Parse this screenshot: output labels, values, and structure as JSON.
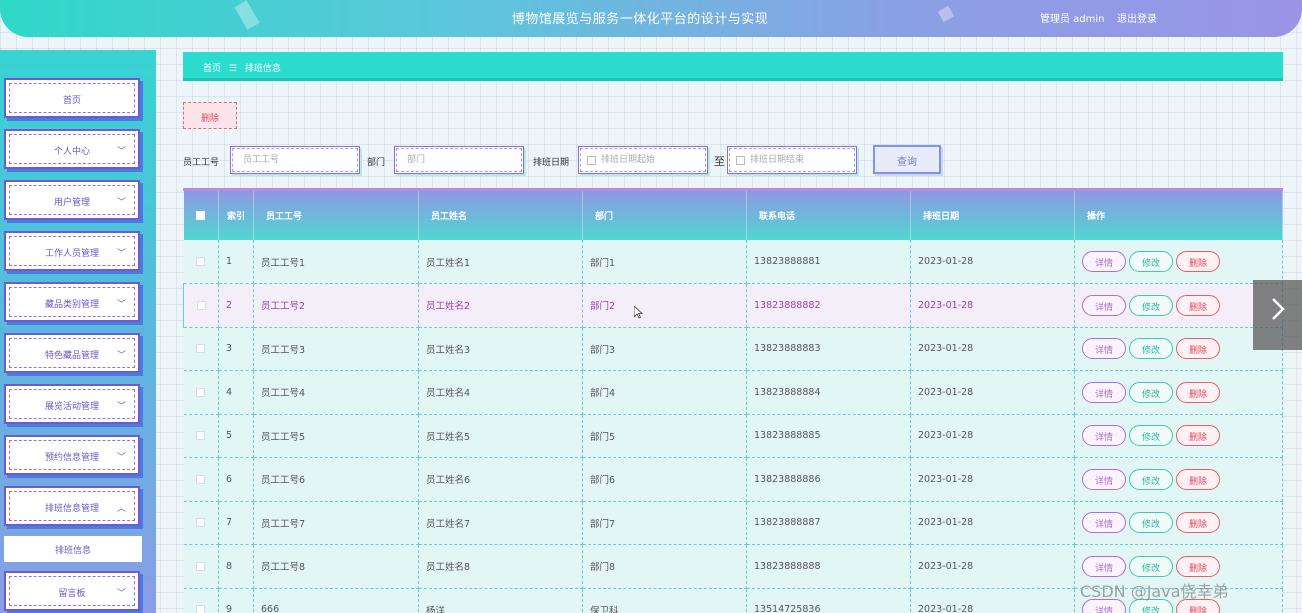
{
  "header": {
    "title": "博物馆展览与服务一体化平台的设计与实现",
    "user": "管理员 admin",
    "logout": "退出登录"
  },
  "sidebar": {
    "items": [
      {
        "label": "首页",
        "chevron": ""
      },
      {
        "label": "个人中心",
        "chevron": "﹀"
      },
      {
        "label": "用户管理",
        "chevron": "﹀"
      },
      {
        "label": "工作人员管理",
        "chevron": "﹀"
      },
      {
        "label": "藏品类别管理",
        "chevron": "﹀"
      },
      {
        "label": "特色藏品管理",
        "chevron": "﹀"
      },
      {
        "label": "展览活动管理",
        "chevron": "﹀"
      },
      {
        "label": "预约信息管理",
        "chevron": "﹀"
      },
      {
        "label": "排班信息管理",
        "chevron": "︿"
      },
      {
        "label": "留言板",
        "chevron": "﹀"
      }
    ],
    "sub_item": "排班信息"
  },
  "breadcrumb": {
    "home": "首页",
    "separator": "☰",
    "current": "排班信息"
  },
  "actions": {
    "delete": "删除",
    "query": "查询",
    "to": "至"
  },
  "search": {
    "emp_no_label": "员工工号",
    "emp_no_placeholder": "员工工号",
    "dept_label": "部门",
    "dept_placeholder": "部门",
    "date_label": "排班日期",
    "date_start_placeholder": "排班日期起始",
    "date_end_placeholder": "排班日期结束"
  },
  "table": {
    "columns": [
      "索引",
      "员工工号",
      "员工姓名",
      "部门",
      "联系电话",
      "排班日期",
      "操作"
    ],
    "ops": {
      "detail": "详情",
      "edit": "修改",
      "delete": "删除"
    },
    "rows": [
      {
        "idx": "1",
        "emp_no": "员工工号1",
        "name": "员工姓名1",
        "dept": "部门1",
        "phone": "13823888881",
        "date": "2023-01-28"
      },
      {
        "idx": "2",
        "emp_no": "员工工号2",
        "name": "员工姓名2",
        "dept": "部门2",
        "phone": "13823888882",
        "date": "2023-01-28"
      },
      {
        "idx": "3",
        "emp_no": "员工工号3",
        "name": "员工姓名3",
        "dept": "部门3",
        "phone": "13823888883",
        "date": "2023-01-28"
      },
      {
        "idx": "4",
        "emp_no": "员工工号4",
        "name": "员工姓名4",
        "dept": "部门4",
        "phone": "13823888884",
        "date": "2023-01-28"
      },
      {
        "idx": "5",
        "emp_no": "员工工号5",
        "name": "员工姓名5",
        "dept": "部门5",
        "phone": "13823888885",
        "date": "2023-01-28"
      },
      {
        "idx": "6",
        "emp_no": "员工工号6",
        "name": "员工姓名6",
        "dept": "部门6",
        "phone": "13823888886",
        "date": "2023-01-28"
      },
      {
        "idx": "7",
        "emp_no": "员工工号7",
        "name": "员工姓名7",
        "dept": "部门7",
        "phone": "13823888887",
        "date": "2023-01-28"
      },
      {
        "idx": "8",
        "emp_no": "员工工号8",
        "name": "员工姓名8",
        "dept": "部门8",
        "phone": "13823888888",
        "date": "2023-01-28"
      },
      {
        "idx": "9",
        "emp_no": "666",
        "name": "杨洋",
        "dept": "保卫科",
        "phone": "13514725836",
        "date": "2023-01-28"
      }
    ]
  },
  "watermark": "CSDN @Java侥幸弟"
}
